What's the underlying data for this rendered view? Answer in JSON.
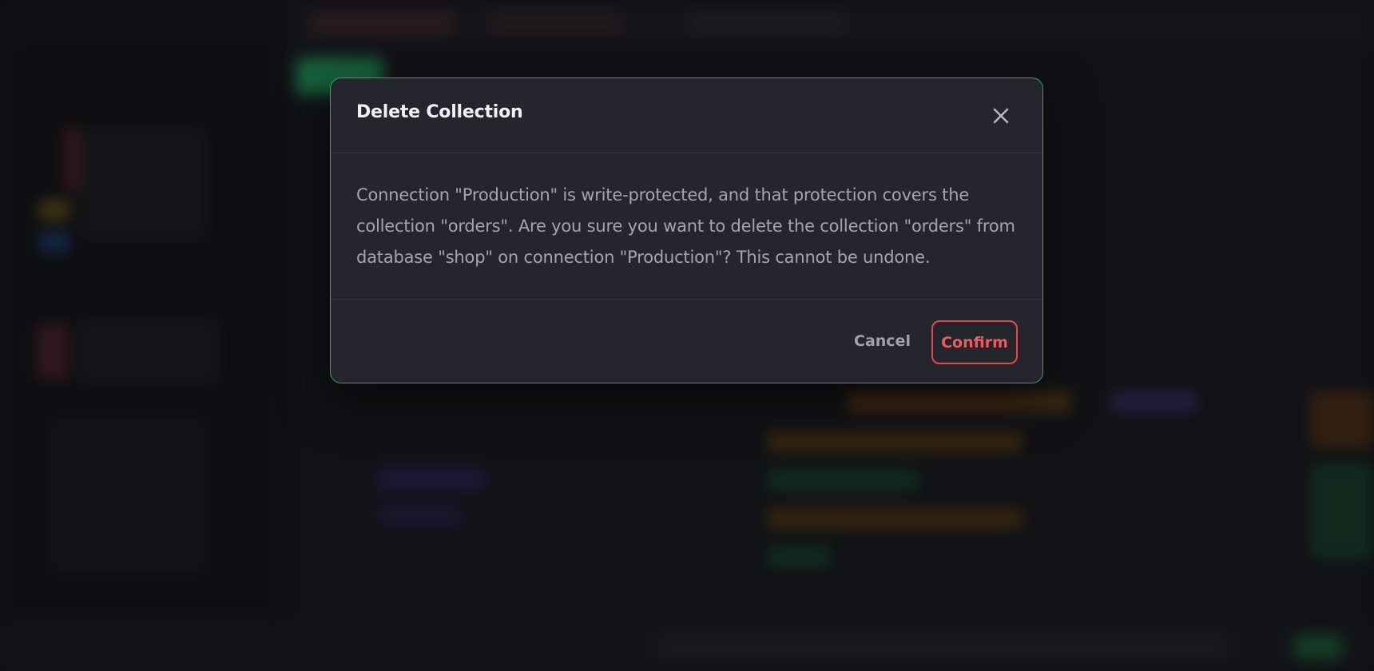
{
  "dialog": {
    "title": "Delete Collection",
    "close_icon": "close-icon",
    "message": "Connection \"Production\" is write-protected, and that protection covers the collection \"orders\". Are you sure you want to delete the collection \"orders\" from database \"shop\" on connection \"Production\"? This cannot be undone.",
    "cancel_label": "Cancel",
    "confirm_label": "Confirm"
  },
  "colors": {
    "dialog_border": "#2fa56a",
    "dialog_background": "#25262d",
    "danger": "#e5484d",
    "backdrop": "#121316"
  }
}
